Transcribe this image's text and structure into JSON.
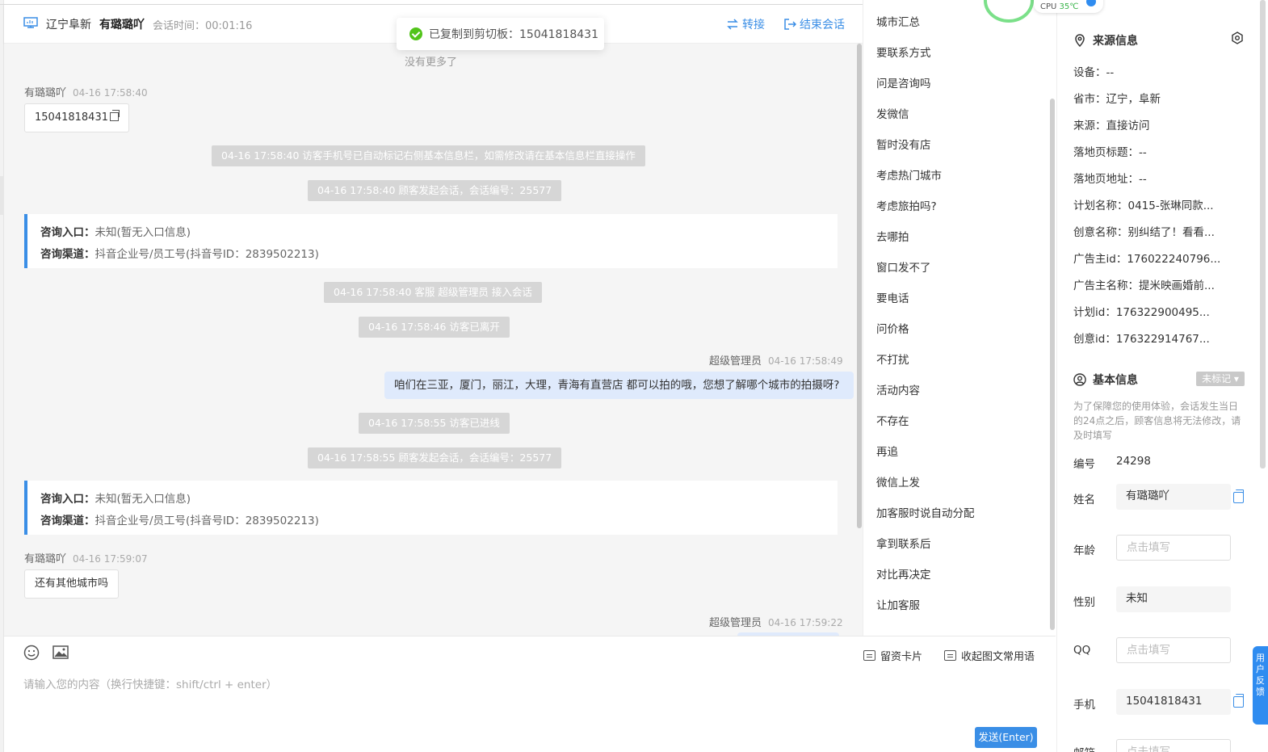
{
  "header": {
    "location": "辽宁阜新",
    "visitor_name": "有璐璐吖",
    "session_time": "会话时间：00:01:16",
    "transfer_label": "转接",
    "end_label": "结束会话"
  },
  "toast": {
    "text": "已复制到剪切板：15041818431"
  },
  "chat": {
    "no_more": "没有更多了",
    "msg1": {
      "sender": "有璐璐吖",
      "time": "04-16 17:58:40",
      "text": "15041818431"
    },
    "sys1": "04-16 17:58:40 访客手机号已自动标记右侧基本信息栏，如需修改请在基本信息栏直接操作",
    "sys2": "04-16 17:58:40 顾客发起会话，会话编号：25577",
    "card1": {
      "entry_label": "咨询入口：",
      "entry_value": "未知(暂无入口信息)",
      "channel_label": "咨询渠道：",
      "channel_value": "抖音企业号/员工号(抖音号ID：2839502213)"
    },
    "sys3": "04-16 17:58:40 客服 超级管理员 接入会话",
    "sys4": "04-16 17:58:46 访客已离开",
    "msg2": {
      "sender": "超级管理员",
      "time": "04-16 17:58:49",
      "text": "咱们在三亚，厦门，丽江，大理，青海有直营店 都可以拍的哦，您想了解哪个城市的拍摄呀?"
    },
    "sys5": "04-16 17:58:55 访客已进线",
    "sys6": "04-16 17:58:55 顾客发起会话，会话编号：25577",
    "card2": {
      "entry_label": "咨询入口：",
      "entry_value": "未知(暂无入口信息)",
      "channel_label": "咨询渠道：",
      "channel_value": "抖音企业号/员工号(抖音号ID：2839502213)"
    },
    "msg3": {
      "sender": "有璐璐吖",
      "time": "04-16 17:59:07",
      "text": "还有其他城市吗"
    },
    "msg4": {
      "sender": "超级管理员",
      "time": "04-16 17:59:22"
    }
  },
  "input": {
    "placeholder": "请输入您的内容（换行快捷键：shift/ctrl + enter）",
    "card_label": "留资卡片",
    "collapse_label": "收起图文常用语",
    "send_label": "发送(Enter)"
  },
  "quick_replies": [
    "城市汇总",
    "要联系方式",
    "问是咨询吗",
    "发微信",
    "暂时没有店",
    "考虑热门城市",
    "考虑旅拍吗?",
    "去哪拍",
    "窗口发不了",
    "要电话",
    "问价格",
    "不打扰",
    "活动内容",
    "不存在",
    "再追",
    "微信上发",
    "加客服时说自动分配",
    "拿到联系后",
    "对比再决定",
    "让加客服"
  ],
  "source_info": {
    "title": "来源信息",
    "lines": [
      "设备：--",
      "省市：辽宁，阜新",
      "来源：直接访问",
      "落地页标题：--",
      "落地页地址：--",
      "计划名称：0415-张琳同款...",
      "创意名称：别纠结了！看看...",
      "广告主id：176022240796...",
      "广告主名称：提米映画婚前...",
      "计划id：176322900495...",
      "创意id：176322914767..."
    ]
  },
  "basic_info": {
    "title": "基本信息",
    "tag": "未标记",
    "notice": "为了保障您的使用体验，会话发生当日的24点之后，顾客信息将无法修改，请及时填写",
    "id_label": "编号",
    "id_value": "24298",
    "name_label": "姓名",
    "name_value": "有璐璐吖",
    "age_label": "年龄",
    "age_placeholder": "点击填写",
    "gender_label": "性别",
    "gender_value": "未知",
    "qq_label": "QQ",
    "qq_placeholder": "点击填写",
    "phone_label": "手机",
    "phone_value": "15041818431",
    "email_label": "邮箱",
    "email_placeholder": "点击填写"
  },
  "overlay": {
    "cpu_label": "CPU",
    "cpu_temp": "35℃",
    "feedback": "用户反馈"
  },
  "colors": {
    "accent": "#3a8ee6",
    "success": "#52c41a",
    "bubble_out": "#dfeafc"
  }
}
